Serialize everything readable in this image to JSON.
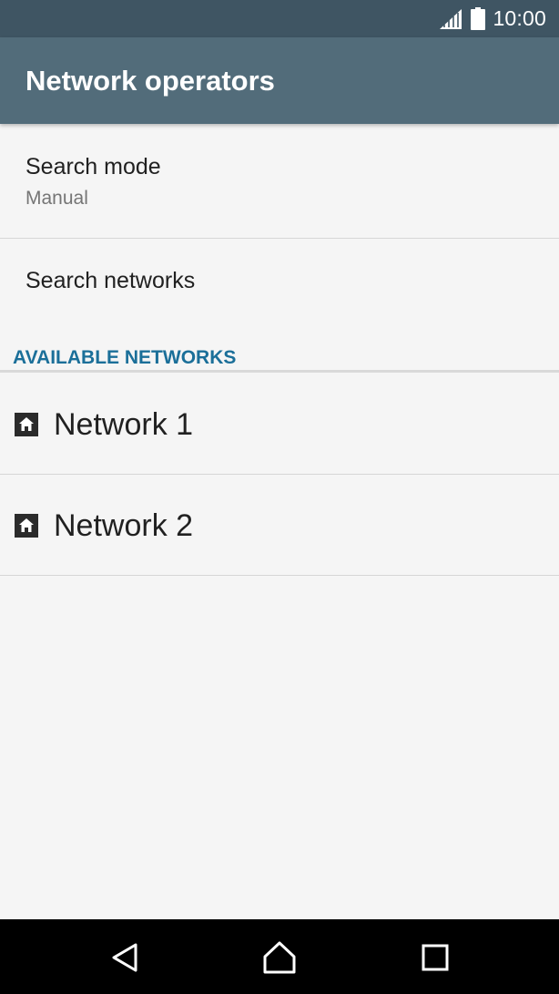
{
  "status_bar": {
    "time": "10:00",
    "signal_icon": "signal-icon",
    "battery_icon": "battery-icon",
    "background": "#3f5563"
  },
  "app_bar": {
    "title": "Network operators",
    "background": "#526c7a"
  },
  "settings": {
    "search_mode": {
      "title": "Search mode",
      "summary": "Manual"
    },
    "search_networks": {
      "title": "Search networks"
    }
  },
  "available_networks": {
    "header": "AVAILABLE NETWORKS",
    "header_color": "#1b6f99",
    "items": [
      {
        "icon": "home-icon",
        "label": "Network 1"
      },
      {
        "icon": "home-icon",
        "label": "Network 2"
      }
    ]
  },
  "nav_bar": {
    "back_icon": "back-icon",
    "home_icon": "home-nav-icon",
    "recents_icon": "recents-icon"
  }
}
